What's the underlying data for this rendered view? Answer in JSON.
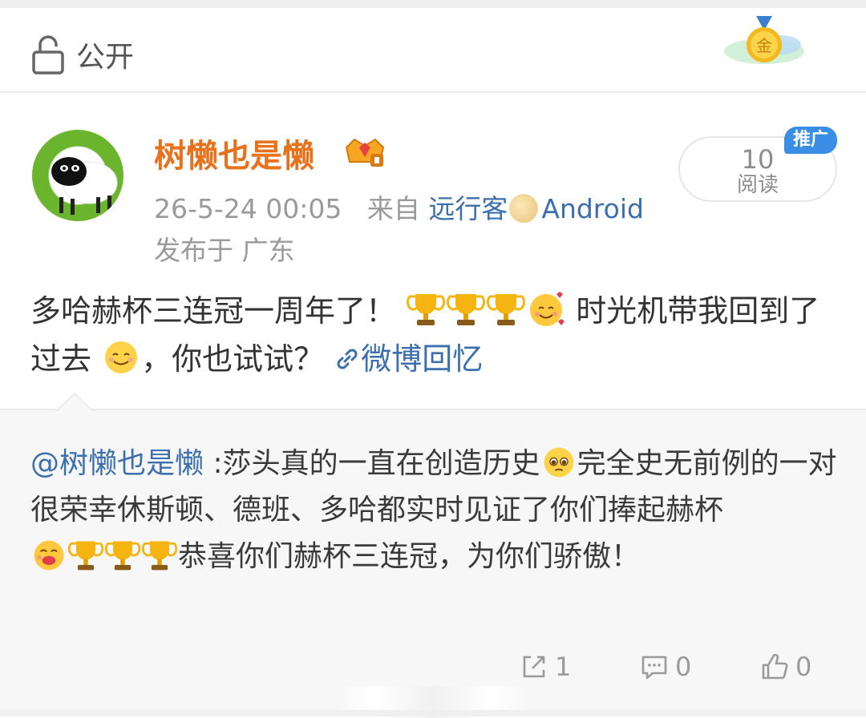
{
  "privacy": {
    "label": "公开",
    "icon": "lock-open-icon"
  },
  "medal": {
    "text": "金"
  },
  "post": {
    "username": "树懒也是懒",
    "timestamp": "26-5-24 00:05",
    "source_prefix": "来自",
    "source_name": "远行客",
    "source_suffix": "Android",
    "location": "发布于 广东",
    "reads": {
      "count": "10",
      "label": "阅读"
    },
    "ad_badge": "推广",
    "text_part1": "多哈赫杯三连冠一周年了！",
    "text_part2": " 时光机带我回到了过去",
    "text_part3": "，你也试试？",
    "link_text": "微博回忆"
  },
  "repost": {
    "mention": "@树懒也是懒",
    "text_part1": " :莎头真的一直在创造历史",
    "text_part2": "完全史无前例的一对",
    "text_part3": "很荣幸休斯顿、德班、多哈都实时见证了你们捧起赫杯",
    "text_part4": "恭喜你们赫杯三连冠，为你们骄傲！"
  },
  "actions": {
    "repost_count": "1",
    "comment_count": "0",
    "like_count": "0"
  },
  "colors": {
    "username": "#e8711b",
    "link": "#3b6fad",
    "ad_badge": "#3b8ee6",
    "repost_bg": "#f7f7f7"
  }
}
